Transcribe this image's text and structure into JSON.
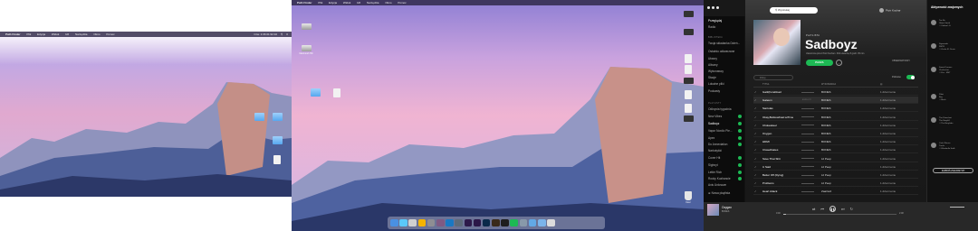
{
  "menubar": {
    "app": "Path Finder",
    "items": [
      "Plik",
      "Edycja",
      "Widok",
      "Idź",
      "Narzędzia",
      "Okno",
      "Pomoc"
    ],
    "clock": "Czw. 1:36  01:32:10"
  },
  "desktop_icons_left": [
    "",
    "",
    "",
    ""
  ],
  "desktop_icons_mid": [
    "",
    "Macintosh HD",
    "",
    "",
    ""
  ],
  "desktop_icons_right": [
    "",
    "",
    "",
    "",
    "",
    "",
    "",
    "",
    "Kosz"
  ],
  "spotify": {
    "search_placeholder": "Wyszukaj",
    "user": "Piotr Kuchar",
    "nav_main": [
      "Przeglądaj",
      "Radio"
    ],
    "library_header": "BIBLIOTEKA",
    "library": [
      "Twoja składanka Dzień...",
      "Ostatnio odtwarzane",
      "Utwory",
      "Albumy",
      "Wykonawcy",
      "Stacje",
      "Lokalne pliki",
      "Podcasty"
    ],
    "playlists_header": "PLAYLISTY",
    "playlists": [
      "Odkrycia tygodnia",
      "New Vibes",
      "Sadboyz",
      "Vapor Nordic Pie...",
      "Apex",
      "Do Annexiation",
      "Narkotykki",
      "Cover Hit",
      "Sighnyt",
      "Lettie Rich",
      "Rocky Kuzhancie",
      "Axis Unknown"
    ],
    "new_playlist": "Nowa playlista",
    "playlist_kind": "PLAYLISTA",
    "playlist_title": "Sadboyz",
    "playlist_meta": "Utworzona przez Piotr Kuchar • 394 utworów, 8 godz. 35 min",
    "play_label": "PAUZA",
    "followers_label": "OBSERWATORZY",
    "filter_placeholder": "Filtruj",
    "download_label": "Pobrane",
    "cols": {
      "title": "TYTUŁ",
      "artist": "WYKONAWCA",
      "date": "",
      "date_icon": "calendar-icon"
    },
    "tracks": [
      {
        "title": "Gatti(ForeRoad",
        "artist": "BONES",
        "date": "1 dzień temu"
      },
      {
        "title": "Gateum",
        "artist": "BONES",
        "date": "1 dzień temu",
        "explicit": "EXPLICIT"
      },
      {
        "title": "Sarcolas",
        "artist": "BONES",
        "date": "1 dzień temu"
      },
      {
        "title": "Okay,ButHowFast.wiTime",
        "artist": "BONES",
        "date": "1 dzień temu"
      },
      {
        "title": "Chokeskeel",
        "artist": "BONES",
        "date": "1 dzień temu"
      },
      {
        "title": "Oxygen",
        "artist": "BONES",
        "date": "1 dzień temu"
      },
      {
        "title": "HDMI",
        "artist": "BONES",
        "date": "1 dzień temu"
      },
      {
        "title": "ClosedGates",
        "artist": "BONES",
        "date": "1 dzień temu"
      },
      {
        "title": "Save That Shit",
        "artist": "Lil Peep",
        "date": "1 dzień temu"
      },
      {
        "title": "U Said",
        "artist": "Lil Peep",
        "date": "1 dzień temu"
      },
      {
        "title": "Better Off (Dying)",
        "artist": "Lil Peep",
        "date": "1 dzień temu"
      },
      {
        "title": "Problems",
        "artist": "Lil Peep",
        "date": "1 dzień temu"
      },
      {
        "title": "Heart Attack",
        "artist": "Zaarlord",
        "date": "1 dzień temu"
      }
    ],
    "friends_header": "Aktywność znajomych",
    "friends": [
      {
        "text": "Tox Ru\nGhost Smith\n♫ Oxbow LG"
      },
      {
        "text": "Sigmundo\nNSTR\n♫ Zache Kl. Dusie"
      },
      {
        "text": "Sweet Dreams\nChxlcocket\n♫ Kia... MST"
      },
      {
        "text": "Pilott\nBoy\n♫ Mesh"
      },
      {
        "text": "The Flowchart\nThe Borghill\n♫ The Borghida"
      },
      {
        "text": "Yush Wierna\nTrasle\n♫ Wondorlle Stalk"
      }
    ],
    "invite_label": "ZAPROŚ ZNAJOMYCH",
    "now_playing_title": "Oxygen",
    "now_playing_artist": "BONES",
    "time_elapsed": "0:00",
    "time_total": "2:08",
    "progress": 0.02
  }
}
